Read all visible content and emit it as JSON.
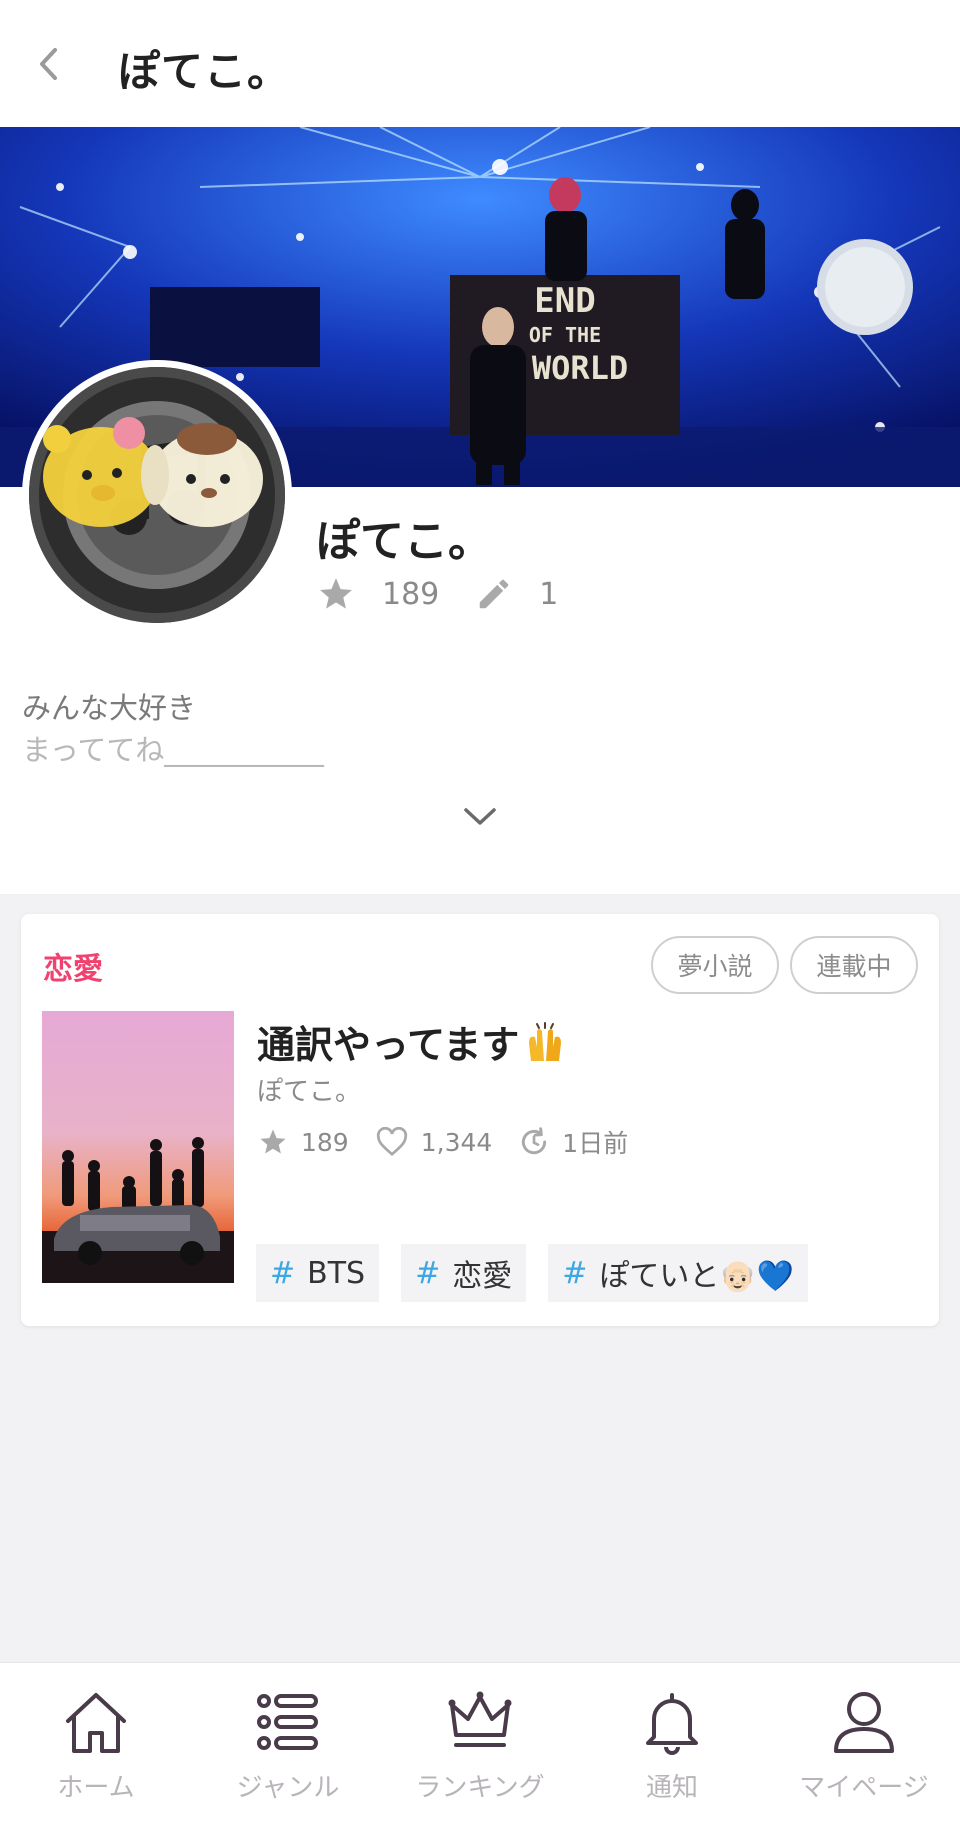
{
  "header": {
    "title": "ぽてこ。"
  },
  "profile": {
    "name": "ぽてこ。",
    "stars": "189",
    "works": "1",
    "bio_line1": "みんな大好き",
    "bio_line2": "まっててね___________"
  },
  "banner": {
    "sign_line1": "END",
    "sign_line2": "OF THE",
    "sign_line3": "WORLD"
  },
  "story": {
    "genre": "恋愛",
    "badges": [
      "夢小説",
      "連載中"
    ],
    "title": "通訳やってます",
    "author": "ぽてこ。",
    "stars": "189",
    "likes": "1,344",
    "updated": "1日前",
    "hashtags": [
      "BTS",
      "恋愛",
      "ぽていと👴🏻💙"
    ]
  },
  "nav": [
    {
      "label": "ホーム",
      "icon": "home-icon"
    },
    {
      "label": "ジャンル",
      "icon": "list-icon"
    },
    {
      "label": "ランキング",
      "icon": "crown-icon"
    },
    {
      "label": "通知",
      "icon": "bell-icon"
    },
    {
      "label": "マイページ",
      "icon": "user-icon"
    }
  ],
  "colors": {
    "accent_pink": "#f0416f",
    "hashtag_blue": "#3ca7e0",
    "nav_icon": "#4a3b4a",
    "nav_label": "#b9b3ba"
  }
}
